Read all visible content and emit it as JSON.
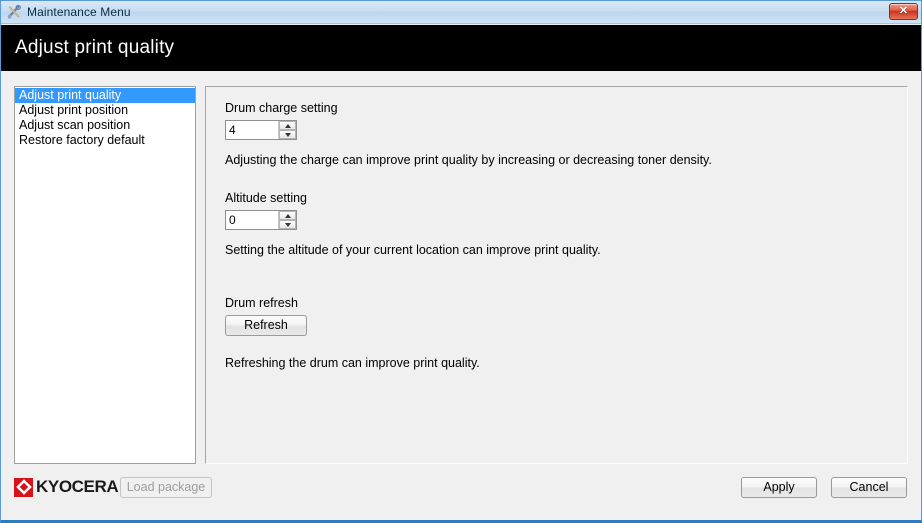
{
  "window": {
    "title": "Maintenance Menu",
    "app_icon": "maintenance-tools-icon",
    "close_label": "✕"
  },
  "banner": {
    "title": "Adjust print quality"
  },
  "sidebar": {
    "items": [
      {
        "label": "Adjust print quality",
        "selected": true
      },
      {
        "label": "Adjust print position",
        "selected": false
      },
      {
        "label": "Adjust scan position",
        "selected": false
      },
      {
        "label": "Restore factory default",
        "selected": false
      }
    ]
  },
  "main": {
    "drum_charge": {
      "label": "Drum charge setting",
      "value": "4",
      "description": "Adjusting the charge can improve print quality by increasing or decreasing toner density."
    },
    "altitude": {
      "label": "Altitude setting",
      "value": "0",
      "description": "Setting the altitude of your current location can improve print quality."
    },
    "drum_refresh": {
      "label": "Drum refresh",
      "button_label": "Refresh",
      "description": "Refreshing the drum can improve print quality."
    }
  },
  "footer": {
    "brand": "KYOCERA",
    "load_package_label": "Load package",
    "apply_label": "Apply",
    "cancel_label": "Cancel"
  },
  "colors": {
    "selection_blue": "#3399ff",
    "brand_red": "#d8121a",
    "banner_black": "#000000"
  }
}
